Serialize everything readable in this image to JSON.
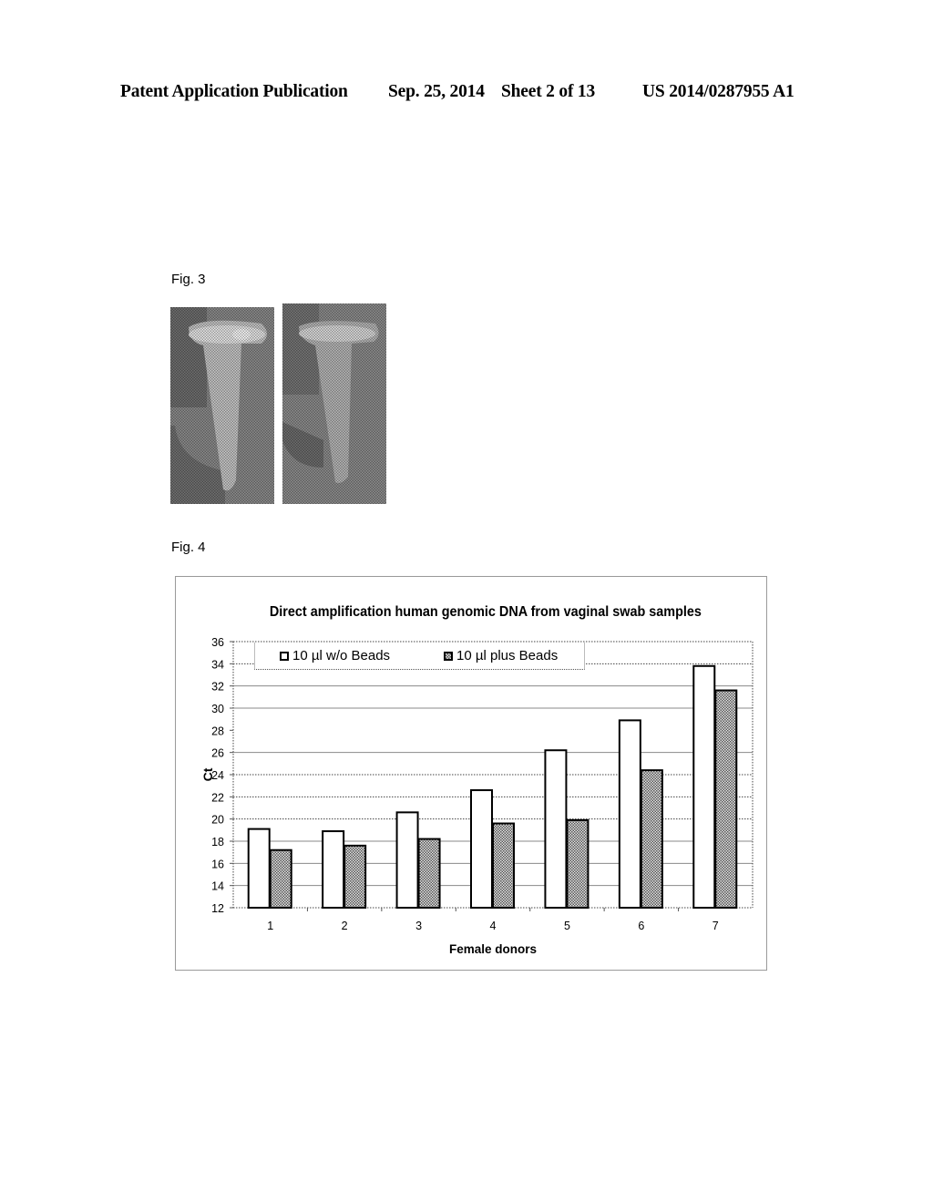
{
  "header": {
    "publication_label": "Patent Application Publication",
    "date": "Sep. 25, 2014",
    "sheet": "Sheet 2 of 13",
    "patent_number": "US 2014/0287955 A1"
  },
  "figures": {
    "fig3_label": "Fig. 3",
    "fig4_label": "Fig. 4",
    "fig3_images": [
      {
        "description": "photo of sample tube without beads"
      },
      {
        "description": "photo of sample tube with beads"
      }
    ]
  },
  "chart_data": {
    "type": "bar",
    "title": "Direct amplification human genomic DNA from vaginal swab samples",
    "xlabel": "Female donors",
    "ylabel": "Ct",
    "categories": [
      "1",
      "2",
      "3",
      "4",
      "5",
      "6",
      "7"
    ],
    "series": [
      {
        "name": "10 µl w/o Beads",
        "fill": "white",
        "values": [
          19.1,
          18.9,
          20.6,
          22.6,
          26.2,
          28.9,
          33.8
        ]
      },
      {
        "name": "10 µl plus Beads",
        "fill": "hatched",
        "values": [
          17.2,
          17.6,
          18.2,
          19.6,
          19.9,
          24.4,
          31.6
        ]
      }
    ],
    "ylim": [
      12,
      36
    ],
    "yticks": [
      12,
      14,
      16,
      18,
      20,
      22,
      24,
      26,
      28,
      30,
      32,
      34,
      36
    ],
    "grid": true,
    "legend_position": "top-left"
  }
}
